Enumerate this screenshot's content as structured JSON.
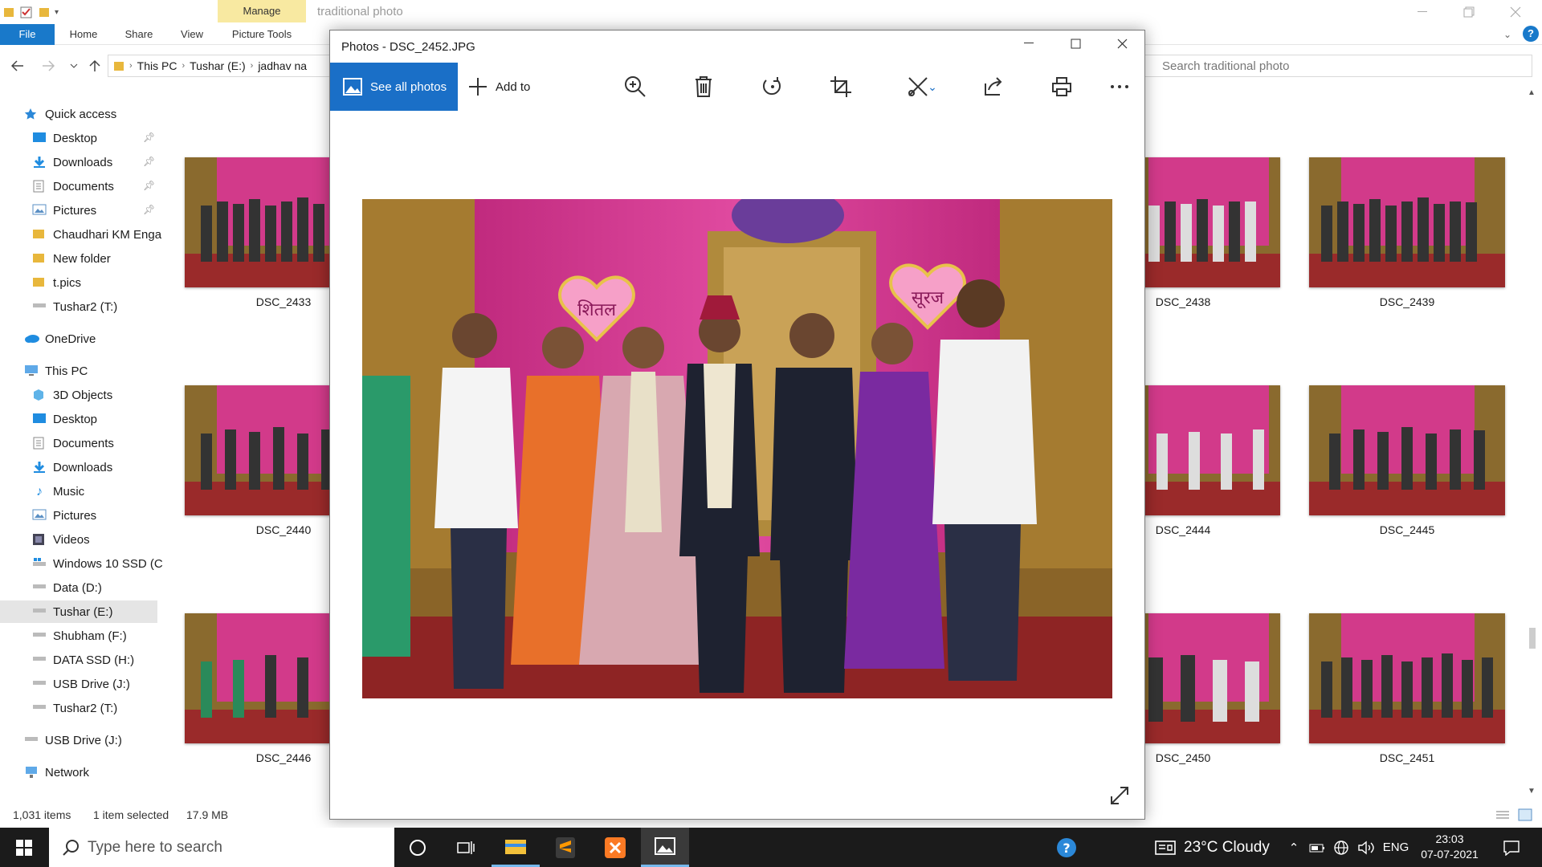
{
  "explorer": {
    "title": "traditional photo",
    "manage_tab": "Manage",
    "ribbon_tabs": [
      "File",
      "Home",
      "Share",
      "View",
      "Picture Tools"
    ],
    "address": [
      "This PC",
      "Tushar (E:)",
      "jadhav na"
    ],
    "search_placeholder": "Search traditional photo",
    "nav": {
      "quick_access": "Quick access",
      "quick_items": [
        "Desktop",
        "Downloads",
        "Documents",
        "Pictures",
        "Chaudhari KM Enga",
        "New folder",
        "t.pics",
        "Tushar2 (T:)"
      ],
      "onedrive": "OneDrive",
      "this_pc": "This PC",
      "pc_items": [
        "3D Objects",
        "Desktop",
        "Documents",
        "Downloads",
        "Music",
        "Pictures",
        "Videos",
        "Windows 10 SSD (C",
        "Data (D:)",
        "Tushar (E:)",
        "Shubham (F:)",
        "DATA SSD (H:)",
        "USB Drive (J:)",
        "Tushar2 (T:)"
      ],
      "usb_drive": "USB Drive (J:)",
      "network": "Network",
      "selected_item": "Tushar (E:)"
    },
    "thumbnails": [
      {
        "label": "DSC_2433"
      },
      {
        "label": "DSC_2438"
      },
      {
        "label": "DSC_2439"
      },
      {
        "label": "DSC_2440"
      },
      {
        "label": "DSC_2444"
      },
      {
        "label": "DSC_2445"
      },
      {
        "label": "DSC_2446"
      },
      {
        "label": "DSC_2450"
      },
      {
        "label": "DSC_2451"
      }
    ],
    "status": {
      "items": "1,031 items",
      "selected": "1 item selected",
      "size": "17.9 MB"
    }
  },
  "photos": {
    "title": "Photos - DSC_2452.JPG",
    "see_all": "See all photos",
    "add_to": "Add to",
    "tools": [
      "zoom-icon",
      "delete-icon",
      "rotate-icon",
      "crop-icon",
      "edit-icon",
      "share-icon",
      "print-icon",
      "more-icon"
    ],
    "stage_signs": [
      "शितल",
      "सूरज"
    ]
  },
  "taskbar": {
    "search_placeholder": "Type here to search",
    "weather": "23°C  Cloudy",
    "lang": "ENG",
    "time": "23:03",
    "date": "07-07-2021"
  },
  "colors": {
    "accent": "#1a6fc7",
    "taskbar": "#1b1b1b",
    "manage": "#f8e9a1"
  }
}
